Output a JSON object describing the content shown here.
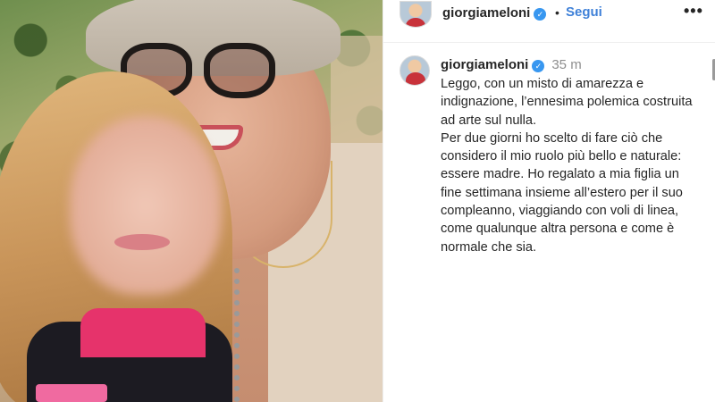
{
  "header": {
    "username": "giorgiameloni",
    "separator": "•",
    "follow_label": "Segui",
    "more_label": "•••"
  },
  "caption": {
    "username": "giorgiameloni",
    "timestamp": "35 m",
    "paragraph_1": "Leggo, con un misto di amarezza e indignazione, l’ennesima polemica costruita ad arte sul nulla.",
    "paragraph_2": "Per due giorni ho scelto di fare ciò che considero il mio ruolo più bello e naturale: essere madre. Ho regalato a mia figlia un fine settimana insieme all’estero per il suo compleanno, viaggiando con voli di linea, come qualunque altra persona e come è normale che sia."
  },
  "icons": {
    "verified": "verified-badge-icon",
    "more": "more-options-icon"
  },
  "colors": {
    "follow_blue": "#3f81d8",
    "verified_blue": "#3897f0",
    "text": "#262626",
    "muted": "#8e8e8e"
  }
}
